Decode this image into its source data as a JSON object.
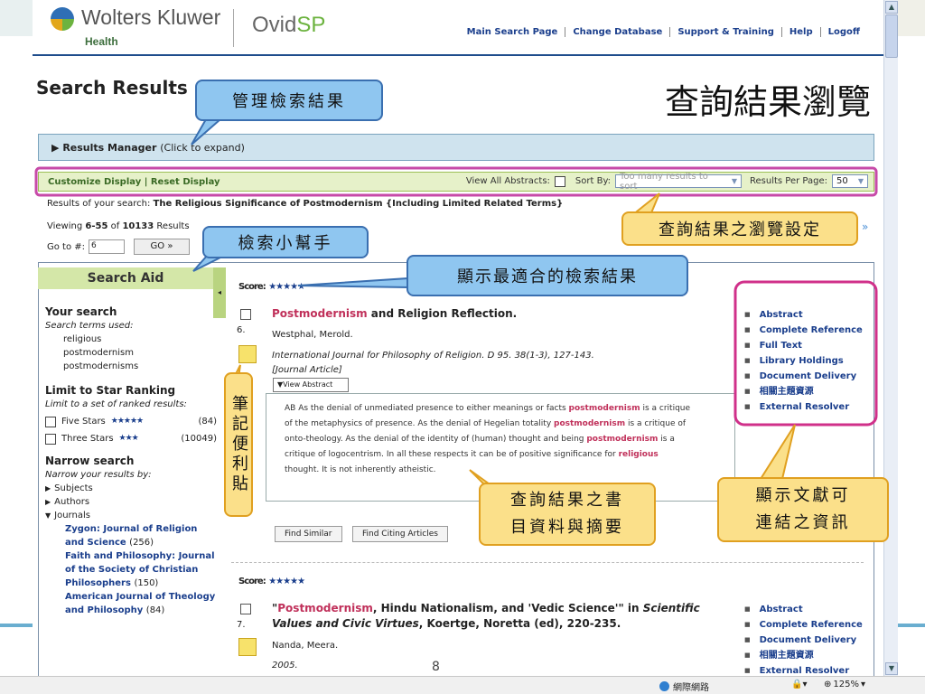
{
  "header": {
    "brand_name": "Wolters Kluwer",
    "brand_sub": "Health",
    "product_a": "Ovid",
    "product_b": "SP",
    "nav": [
      "Main Search Page",
      "Change Database",
      "Support & Training",
      "Help",
      "Logoff"
    ]
  },
  "page_title": "Search Results",
  "big_title": "查詢結果瀏覽",
  "results_manager": {
    "label": "Results Manager",
    "hint": "(Click to expand)"
  },
  "display_bar": {
    "customize": "Customize Display",
    "sep": "|",
    "reset": "Reset Display",
    "view_abstracts": "View All Abstracts:",
    "sort_by": "Sort By:",
    "sort_value": "Too many results to sort",
    "per_page_label": "Results Per Page:",
    "per_page_value": "50"
  },
  "search_line": {
    "prefix": "Results of your search:",
    "query": "The Religious Significance of Postmodernism {Including Limited Related Terms}"
  },
  "viewing": {
    "prefix": "Viewing",
    "range": "6-55",
    "of": "of",
    "total": "10133",
    "suffix": "Results"
  },
  "goto": {
    "label": "Go to #:",
    "value": "6",
    "button": "GO »"
  },
  "next": "»",
  "sidebar": {
    "header": "Search Aid",
    "your_search": "Your search",
    "terms_used": "Search terms used:",
    "terms": [
      "religious",
      "postmodernism",
      "postmodernisms"
    ],
    "limit_star": "Limit to Star Ranking",
    "limit_sub": "Limit to a set of ranked results:",
    "stars": [
      {
        "label": "Five Stars",
        "stars": "★★★★★",
        "count": "(84)"
      },
      {
        "label": "Three Stars",
        "stars": "★★★",
        "count": "(10049)"
      }
    ],
    "narrow": "Narrow search",
    "narrow_sub": "Narrow your results by:",
    "facets": [
      "Subjects",
      "Authors",
      "Journals"
    ],
    "journals": [
      {
        "name": "Zygon: Journal of Religion and Science",
        "count": "(256)"
      },
      {
        "name": "Faith and Philosophy: Journal of the Society of Christian Philosophers",
        "count": "(150)"
      },
      {
        "name": "American Journal of Theology and Philosophy",
        "count": "(84)"
      }
    ]
  },
  "results": [
    {
      "score_label": "Score:",
      "stars": "★★★★★",
      "number": "6.",
      "title_hl": "Postmodernism",
      "title_rest": " and Religion Reflection.",
      "author": "Westphal, Merold.",
      "source": "International Journal for Philosophy of Religion. D 95. 38(1-3), 127-143.",
      "type": "[Journal Article]",
      "abstract_toggle": "▼View Abstract",
      "abstract": [
        [
          "AB As the denial of unmediated presence to either meanings or facts ",
          "postmodernism",
          " is a critique"
        ],
        [
          "of the metaphysics of presence. As the denial of Hegelian totality ",
          "postmodernism",
          " is a critique of"
        ],
        [
          "onto-theology. As the denial of the identity of (human) thought and being ",
          "postmodernism",
          " is a"
        ],
        [
          "critique of logocentrism. In all these respects it can be of positive significance for ",
          "religious",
          ""
        ],
        [
          "thought. It is not inherently atheistic.",
          "",
          ""
        ]
      ],
      "buttons": [
        "Find Similar",
        "Find Citing Articles"
      ],
      "actions": [
        "Abstract",
        "Complete Reference",
        "Full Text",
        "Library Holdings",
        "Document Delivery",
        "相關主題資源",
        "External Resolver"
      ]
    },
    {
      "score_label": "Score:",
      "stars": "★★★★★",
      "number": "7.",
      "title_pre": "\"",
      "title_hl": "Postmodernism",
      "title_mid": ", Hindu Nationalism, and 'Vedic Science'\" in ",
      "title_it": "Scientific Values and Civic Virtues",
      "title_rest": ", Koertge, Noretta (ed), 220-235.",
      "author": "Nanda, Meera.",
      "year": "2005.",
      "actions": [
        "Abstract",
        "Complete Reference",
        "Document Delivery",
        "相關主題資源",
        "External Resolver"
      ]
    }
  ],
  "callouts": {
    "manage": "管理檢索結果",
    "aid": "檢索小幫手",
    "best": "顯示最適合的檢索結果",
    "settings": "查詢結果之瀏覽設定",
    "note": "筆記便利貼",
    "biblio_1": "查詢結果之書",
    "biblio_2": "目資料與摘要",
    "links_1": "顯示文獻可",
    "links_2": "連結之資訊"
  },
  "slide_number": "8",
  "statusbar": {
    "zone": "網際網路",
    "zoom": "125%"
  },
  "colors": {
    "accent": "#1a3e8c",
    "highlight": "#c0305a",
    "manager_bar": "#cfe3ee",
    "display_bar": "#e6f1c9",
    "callout_blue": "#8fc6f0",
    "callout_yellow": "#fbe08a",
    "frame_magenta": "#d0308a"
  }
}
